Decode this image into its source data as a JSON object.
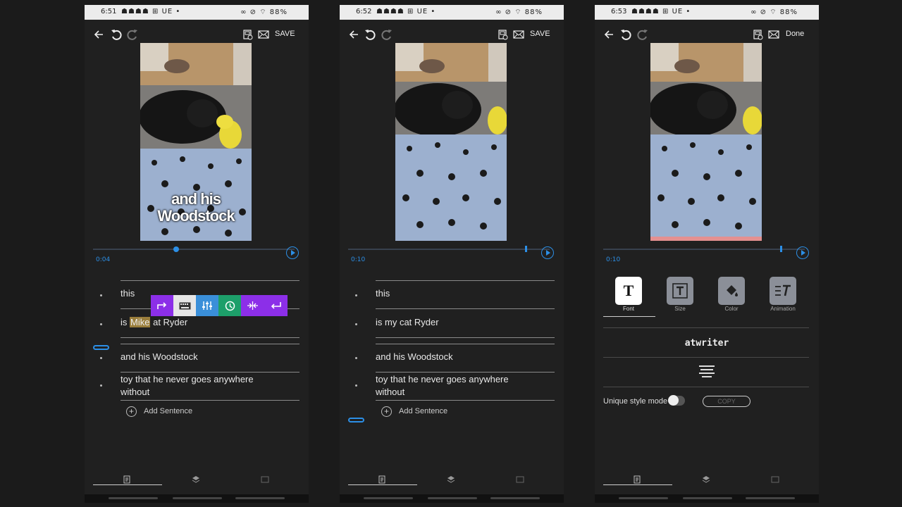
{
  "panels": [
    {
      "status": {
        "time": "6:51",
        "icons_left": "☗☗☗☗ ⊞ UE •",
        "icons_right": "∞ ⊘ ⌔ 88%"
      },
      "header": {
        "save_label": "SAVE"
      },
      "video": {
        "caption_line1": "and his",
        "caption_line2": "Woodstock"
      },
      "timeline": {
        "time": "0:04",
        "progress": 0.37
      },
      "sentences": {
        "s1": "this",
        "s2_prefix": "is",
        "s2_highlight": "Mike",
        "s2_suffix": "at Ryder",
        "s3": "and his Woodstock",
        "s4_line1": "toy that he never goes anywhere",
        "s4_line2": "without"
      },
      "add_sentence": "Add Sentence",
      "popup_toolbar": {
        "colors": [
          "#8c2fe8",
          "#e6e6e6",
          "#3a8fd9",
          "#1d9f6a",
          "#8c2fe8",
          "#8c2fe8"
        ],
        "icons": [
          "redirect-arrow-icon",
          "keyboard-icon",
          "sliders-icon",
          "clock-icon",
          "split-icon",
          "enter-icon"
        ]
      }
    },
    {
      "status": {
        "time": "6:52",
        "icons_left": "☗☗☗☗ ⊞ UE •",
        "icons_right": "∞ ⊘ ⌔ 88%"
      },
      "header": {
        "save_label": "SAVE"
      },
      "timeline": {
        "time": "0:10",
        "progress": 1.0
      },
      "sentences": {
        "s1": "this",
        "s2": "is my cat Ryder",
        "s3": "and his Woodstock",
        "s4_line1": "toy that he never goes anywhere",
        "s4_line2": "without"
      },
      "add_sentence": "Add Sentence"
    },
    {
      "status": {
        "time": "6:53",
        "icons_left": "☗☗☗☗ ⊞ UE •",
        "icons_right": "∞ ⊘ ⌔ 88%"
      },
      "header": {
        "done_label": "Done"
      },
      "timeline": {
        "time": "0:10",
        "progress": 1.0
      },
      "style_tabs": {
        "font": "Font",
        "size": "Size",
        "color": "Color",
        "animation": "Animation"
      },
      "font_name": "atwriter",
      "unique_style_mode": "Unique style mode",
      "copy_label": "COPY"
    }
  ],
  "colors": {
    "accent": "#2c8fe6",
    "panel_bg": "#202020",
    "page_bg": "#1b1b1b",
    "highlight": "#9a7e3c",
    "pink_strip": "#e49090"
  }
}
